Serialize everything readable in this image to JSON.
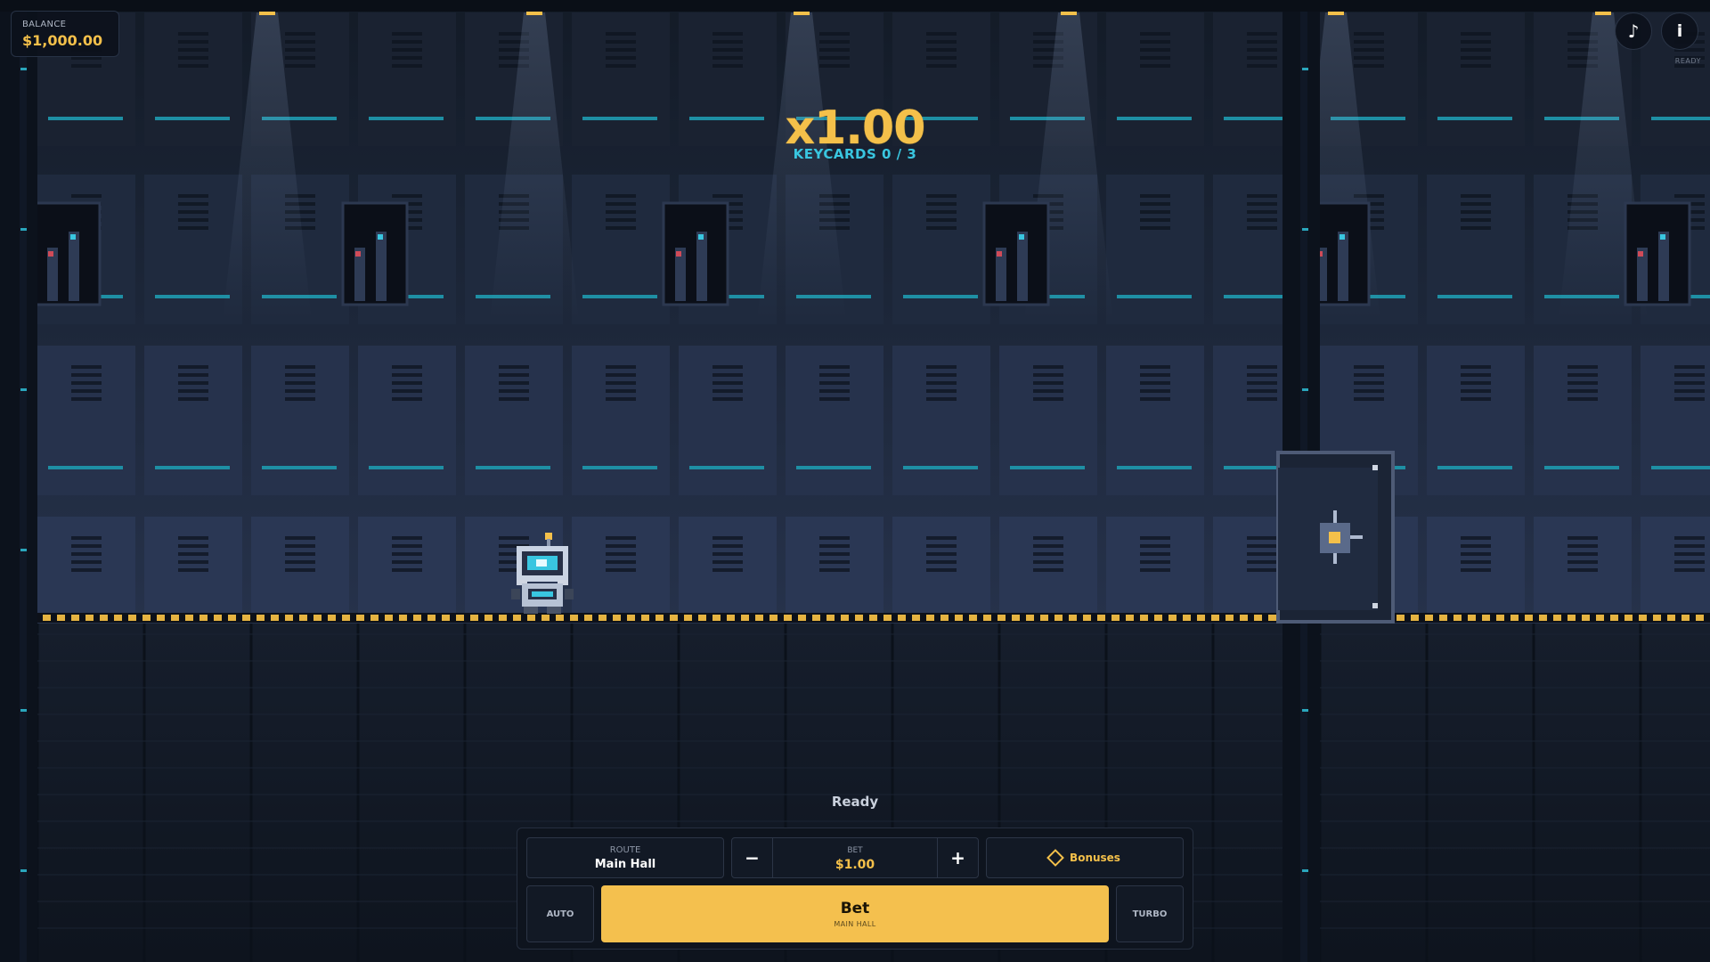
{
  "balance": {
    "label": "BALANCE",
    "value": "$1,000.00"
  },
  "top_controls": {
    "music_icon": "music-note-icon",
    "info_label": "i",
    "status": "READY"
  },
  "game": {
    "multiplier": "x1.00",
    "keycards": "KEYCARDS 0 / 3",
    "status": "Ready"
  },
  "panel": {
    "route": {
      "label": "ROUTE",
      "value": "Main Hall"
    },
    "bet": {
      "label": "BET",
      "value": "$1.00",
      "minus": "−",
      "plus": "+"
    },
    "bonuses": {
      "label": "Bonuses",
      "icon": "diamond-icon"
    },
    "auto_label": "AUTO",
    "turbo_label": "TURBO",
    "bet_button": {
      "label": "Bet",
      "sub": "MAIN HALL"
    }
  },
  "colors": {
    "accent": "#f4c04a",
    "cyan": "#39c6e0",
    "background": "#0b111b"
  }
}
